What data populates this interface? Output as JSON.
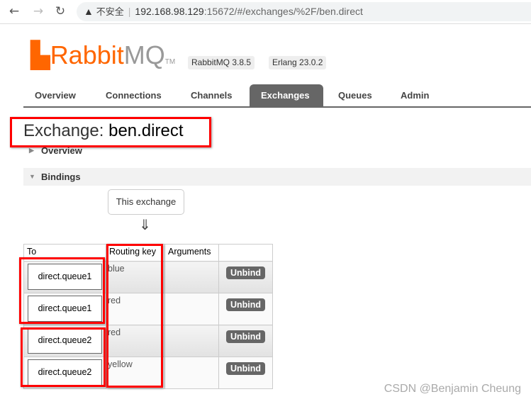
{
  "browser": {
    "security_label": "不安全",
    "url_host": "192.168.98.129",
    "url_rest": ":15672/#/exchanges/%2F/ben.direct"
  },
  "logo": {
    "rabbit": "Rabbit",
    "mq": "MQ",
    "tm": "TM"
  },
  "badges": [
    "RabbitMQ 3.8.5",
    "Erlang 23.0.2"
  ],
  "tabs": [
    {
      "label": "Overview"
    },
    {
      "label": "Connections"
    },
    {
      "label": "Channels"
    },
    {
      "label": "Exchanges",
      "active": true
    },
    {
      "label": "Queues"
    },
    {
      "label": "Admin"
    }
  ],
  "page": {
    "title_prefix": "Exchange:",
    "title_name": "ben.direct",
    "overview_section": "Overview",
    "bindings_section": "Bindings",
    "this_exchange": "This exchange",
    "arrow": "⇓"
  },
  "bindings": {
    "headers": [
      "To",
      "Routing key",
      "Arguments",
      ""
    ],
    "rows": [
      {
        "to": "direct.queue1",
        "routing_key": "blue",
        "arguments": "",
        "action": "Unbind"
      },
      {
        "to": "direct.queue1",
        "routing_key": "red",
        "arguments": "",
        "action": "Unbind"
      },
      {
        "to": "direct.queue2",
        "routing_key": "red",
        "arguments": "",
        "action": "Unbind"
      },
      {
        "to": "direct.queue2",
        "routing_key": "yellow",
        "arguments": "",
        "action": "Unbind"
      }
    ]
  },
  "watermark": "CSDN @Benjamin Cheung"
}
